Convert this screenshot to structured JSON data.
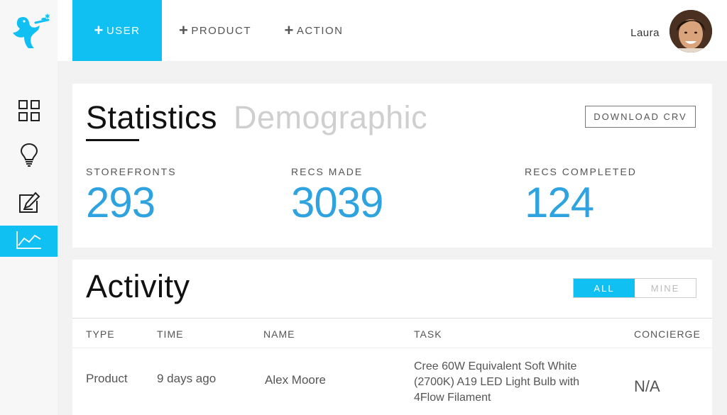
{
  "nav": {
    "tabs": [
      {
        "label": "USER",
        "active": true
      },
      {
        "label": "PRODUCT",
        "active": false
      },
      {
        "label": "ACTION",
        "active": false
      }
    ],
    "plus_icon": "+",
    "user_name": "Laura"
  },
  "sidebar": {
    "items": [
      {
        "icon": "grid-icon",
        "active": false
      },
      {
        "icon": "lightbulb-icon",
        "active": false
      },
      {
        "icon": "edit-icon",
        "active": false
      },
      {
        "icon": "chart-line-icon",
        "active": true
      }
    ]
  },
  "stats": {
    "tabs": {
      "statistics": "Statistics",
      "demographic": "Demographic"
    },
    "download_label": "DOWNLOAD CRV",
    "metrics": [
      {
        "label": "STOREFRONTS",
        "value": "293"
      },
      {
        "label": "RECS MADE",
        "value": "3039"
      },
      {
        "label": "RECS COMPLETED",
        "value": "124"
      }
    ]
  },
  "activity": {
    "title": "Activity",
    "filters": {
      "all": "ALL",
      "mine": "MINE"
    },
    "columns": {
      "type": "TYPE",
      "time": "TIME",
      "name": "NAME",
      "task": "TASK",
      "concierge": "CONCIERGE"
    },
    "rows": [
      {
        "type": "Product",
        "time": "9 days ago",
        "name": "Alex Moore",
        "task": "Cree 60W Equivalent Soft White (2700K) A19 LED Light Bulb with 4Flow Filament",
        "concierge": "N/A"
      }
    ]
  },
  "colors": {
    "accent": "#10c0f3",
    "metric": "#2ea3e0"
  }
}
